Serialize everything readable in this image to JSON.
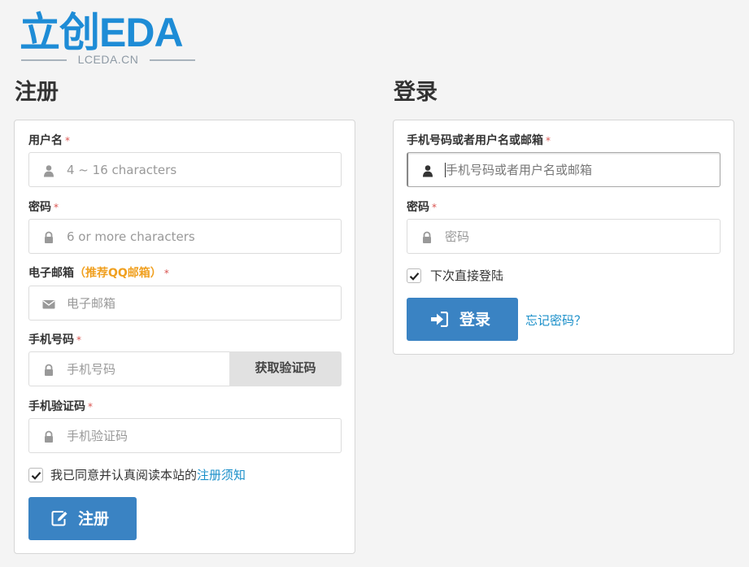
{
  "logo": {
    "main": "立创EDA",
    "sub": "LCEDA.CN"
  },
  "register": {
    "title": "注册",
    "username": {
      "label": "用户名",
      "required": "*",
      "placeholder": "4 ~ 16 characters"
    },
    "password": {
      "label": "密码",
      "required": "*",
      "placeholder": "6 or more characters"
    },
    "email": {
      "label": "电子邮箱",
      "hint": "（推荐QQ邮箱）",
      "required": "*",
      "placeholder": "电子邮箱"
    },
    "phone": {
      "label": "手机号码",
      "required": "*",
      "placeholder": "手机号码",
      "sms_button": "获取验证码"
    },
    "code": {
      "label": "手机验证码",
      "required": "*",
      "placeholder": "手机验证码"
    },
    "agree": {
      "checked": true,
      "text": "我已同意并认真阅读本站的",
      "link": "注册须知"
    },
    "submit": "注册"
  },
  "login": {
    "title": "登录",
    "account": {
      "label": "手机号码或者用户名或邮箱",
      "required": "*",
      "placeholder": "手机号码或者用户名或邮箱"
    },
    "password": {
      "label": "密码",
      "required": "*",
      "placeholder": "密码"
    },
    "remember": {
      "checked": true,
      "text": "下次直接登陆"
    },
    "submit": "登录",
    "forgot": "忘记密码？"
  },
  "colors": {
    "brand": "#1e8cd6",
    "primary_button": "#3a83c3",
    "link": "#1a8fc9",
    "required": "#d9534f",
    "hint": "#f0a020"
  },
  "icons": [
    "user-icon",
    "lock-icon",
    "envelope-icon",
    "edit-icon",
    "sign-in-icon",
    "check-icon"
  ]
}
